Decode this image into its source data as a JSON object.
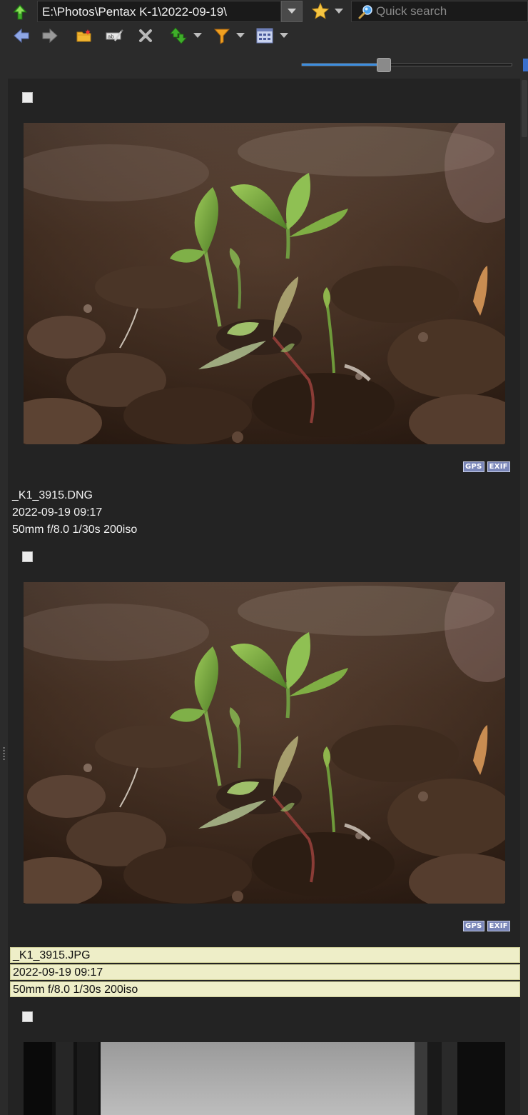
{
  "address_bar": {
    "path": "E:\\Photos\\Pentax K-1\\2022-09-19\\",
    "search_placeholder": "Quick search"
  },
  "icons": {
    "up": "up-arrow-icon",
    "dropdown": "chevron-down-icon",
    "favorite": "star-icon",
    "search": "magnifier-icon",
    "back": "back-arrow-icon",
    "forward": "forward-arrow-icon",
    "new_folder": "new-folder-icon",
    "rename": "rename-icon",
    "delete": "delete-icon",
    "sort": "sort-icon",
    "filter": "filter-icon",
    "view_mode": "view-mode-icon"
  },
  "colors": {
    "accent": "#3d8ee0",
    "selected_row_bg": "#eeeec8",
    "panel_bg": "#232323",
    "toolbar_bg": "#2b2b2b"
  },
  "thumbnail_size_slider": {
    "value": 0.39
  },
  "items": [
    {
      "filename": "_K1_3915.DNG",
      "date": "2022-09-19 09:17",
      "exposure": "50mm f/8.0 1/30s 200iso",
      "badges": [
        "GPS",
        "EXIF"
      ],
      "selected": false,
      "checked": false
    },
    {
      "filename": "_K1_3915.JPG",
      "date": "2022-09-19 09:17",
      "exposure": "50mm f/8.0 1/30s 200iso",
      "badges": [
        "GPS",
        "EXIF"
      ],
      "selected": true,
      "checked": false
    },
    {
      "filename": "",
      "date": "",
      "exposure": "",
      "badges": [],
      "selected": false,
      "checked": false
    }
  ]
}
